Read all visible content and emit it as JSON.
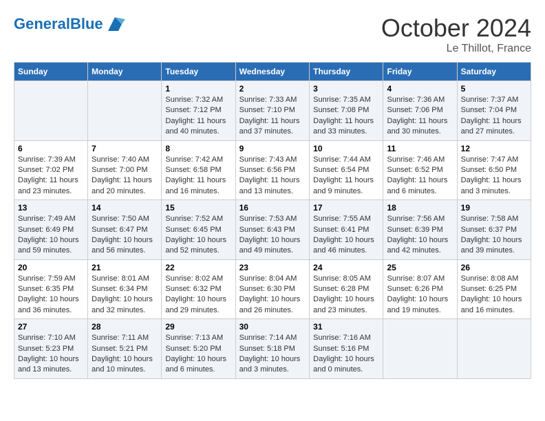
{
  "header": {
    "logo_general": "General",
    "logo_blue": "Blue",
    "month": "October 2024",
    "location": "Le Thillot, France"
  },
  "weekdays": [
    "Sunday",
    "Monday",
    "Tuesday",
    "Wednesday",
    "Thursday",
    "Friday",
    "Saturday"
  ],
  "weeks": [
    [
      {
        "day": "",
        "info": ""
      },
      {
        "day": "",
        "info": ""
      },
      {
        "day": "1",
        "info": "Sunrise: 7:32 AM\nSunset: 7:12 PM\nDaylight: 11 hours and 40 minutes."
      },
      {
        "day": "2",
        "info": "Sunrise: 7:33 AM\nSunset: 7:10 PM\nDaylight: 11 hours and 37 minutes."
      },
      {
        "day": "3",
        "info": "Sunrise: 7:35 AM\nSunset: 7:08 PM\nDaylight: 11 hours and 33 minutes."
      },
      {
        "day": "4",
        "info": "Sunrise: 7:36 AM\nSunset: 7:06 PM\nDaylight: 11 hours and 30 minutes."
      },
      {
        "day": "5",
        "info": "Sunrise: 7:37 AM\nSunset: 7:04 PM\nDaylight: 11 hours and 27 minutes."
      }
    ],
    [
      {
        "day": "6",
        "info": "Sunrise: 7:39 AM\nSunset: 7:02 PM\nDaylight: 11 hours and 23 minutes."
      },
      {
        "day": "7",
        "info": "Sunrise: 7:40 AM\nSunset: 7:00 PM\nDaylight: 11 hours and 20 minutes."
      },
      {
        "day": "8",
        "info": "Sunrise: 7:42 AM\nSunset: 6:58 PM\nDaylight: 11 hours and 16 minutes."
      },
      {
        "day": "9",
        "info": "Sunrise: 7:43 AM\nSunset: 6:56 PM\nDaylight: 11 hours and 13 minutes."
      },
      {
        "day": "10",
        "info": "Sunrise: 7:44 AM\nSunset: 6:54 PM\nDaylight: 11 hours and 9 minutes."
      },
      {
        "day": "11",
        "info": "Sunrise: 7:46 AM\nSunset: 6:52 PM\nDaylight: 11 hours and 6 minutes."
      },
      {
        "day": "12",
        "info": "Sunrise: 7:47 AM\nSunset: 6:50 PM\nDaylight: 11 hours and 3 minutes."
      }
    ],
    [
      {
        "day": "13",
        "info": "Sunrise: 7:49 AM\nSunset: 6:49 PM\nDaylight: 10 hours and 59 minutes."
      },
      {
        "day": "14",
        "info": "Sunrise: 7:50 AM\nSunset: 6:47 PM\nDaylight: 10 hours and 56 minutes."
      },
      {
        "day": "15",
        "info": "Sunrise: 7:52 AM\nSunset: 6:45 PM\nDaylight: 10 hours and 52 minutes."
      },
      {
        "day": "16",
        "info": "Sunrise: 7:53 AM\nSunset: 6:43 PM\nDaylight: 10 hours and 49 minutes."
      },
      {
        "day": "17",
        "info": "Sunrise: 7:55 AM\nSunset: 6:41 PM\nDaylight: 10 hours and 46 minutes."
      },
      {
        "day": "18",
        "info": "Sunrise: 7:56 AM\nSunset: 6:39 PM\nDaylight: 10 hours and 42 minutes."
      },
      {
        "day": "19",
        "info": "Sunrise: 7:58 AM\nSunset: 6:37 PM\nDaylight: 10 hours and 39 minutes."
      }
    ],
    [
      {
        "day": "20",
        "info": "Sunrise: 7:59 AM\nSunset: 6:35 PM\nDaylight: 10 hours and 36 minutes."
      },
      {
        "day": "21",
        "info": "Sunrise: 8:01 AM\nSunset: 6:34 PM\nDaylight: 10 hours and 32 minutes."
      },
      {
        "day": "22",
        "info": "Sunrise: 8:02 AM\nSunset: 6:32 PM\nDaylight: 10 hours and 29 minutes."
      },
      {
        "day": "23",
        "info": "Sunrise: 8:04 AM\nSunset: 6:30 PM\nDaylight: 10 hours and 26 minutes."
      },
      {
        "day": "24",
        "info": "Sunrise: 8:05 AM\nSunset: 6:28 PM\nDaylight: 10 hours and 23 minutes."
      },
      {
        "day": "25",
        "info": "Sunrise: 8:07 AM\nSunset: 6:26 PM\nDaylight: 10 hours and 19 minutes."
      },
      {
        "day": "26",
        "info": "Sunrise: 8:08 AM\nSunset: 6:25 PM\nDaylight: 10 hours and 16 minutes."
      }
    ],
    [
      {
        "day": "27",
        "info": "Sunrise: 7:10 AM\nSunset: 5:23 PM\nDaylight: 10 hours and 13 minutes."
      },
      {
        "day": "28",
        "info": "Sunrise: 7:11 AM\nSunset: 5:21 PM\nDaylight: 10 hours and 10 minutes."
      },
      {
        "day": "29",
        "info": "Sunrise: 7:13 AM\nSunset: 5:20 PM\nDaylight: 10 hours and 6 minutes."
      },
      {
        "day": "30",
        "info": "Sunrise: 7:14 AM\nSunset: 5:18 PM\nDaylight: 10 hours and 3 minutes."
      },
      {
        "day": "31",
        "info": "Sunrise: 7:16 AM\nSunset: 5:16 PM\nDaylight: 10 hours and 0 minutes."
      },
      {
        "day": "",
        "info": ""
      },
      {
        "day": "",
        "info": ""
      }
    ]
  ]
}
